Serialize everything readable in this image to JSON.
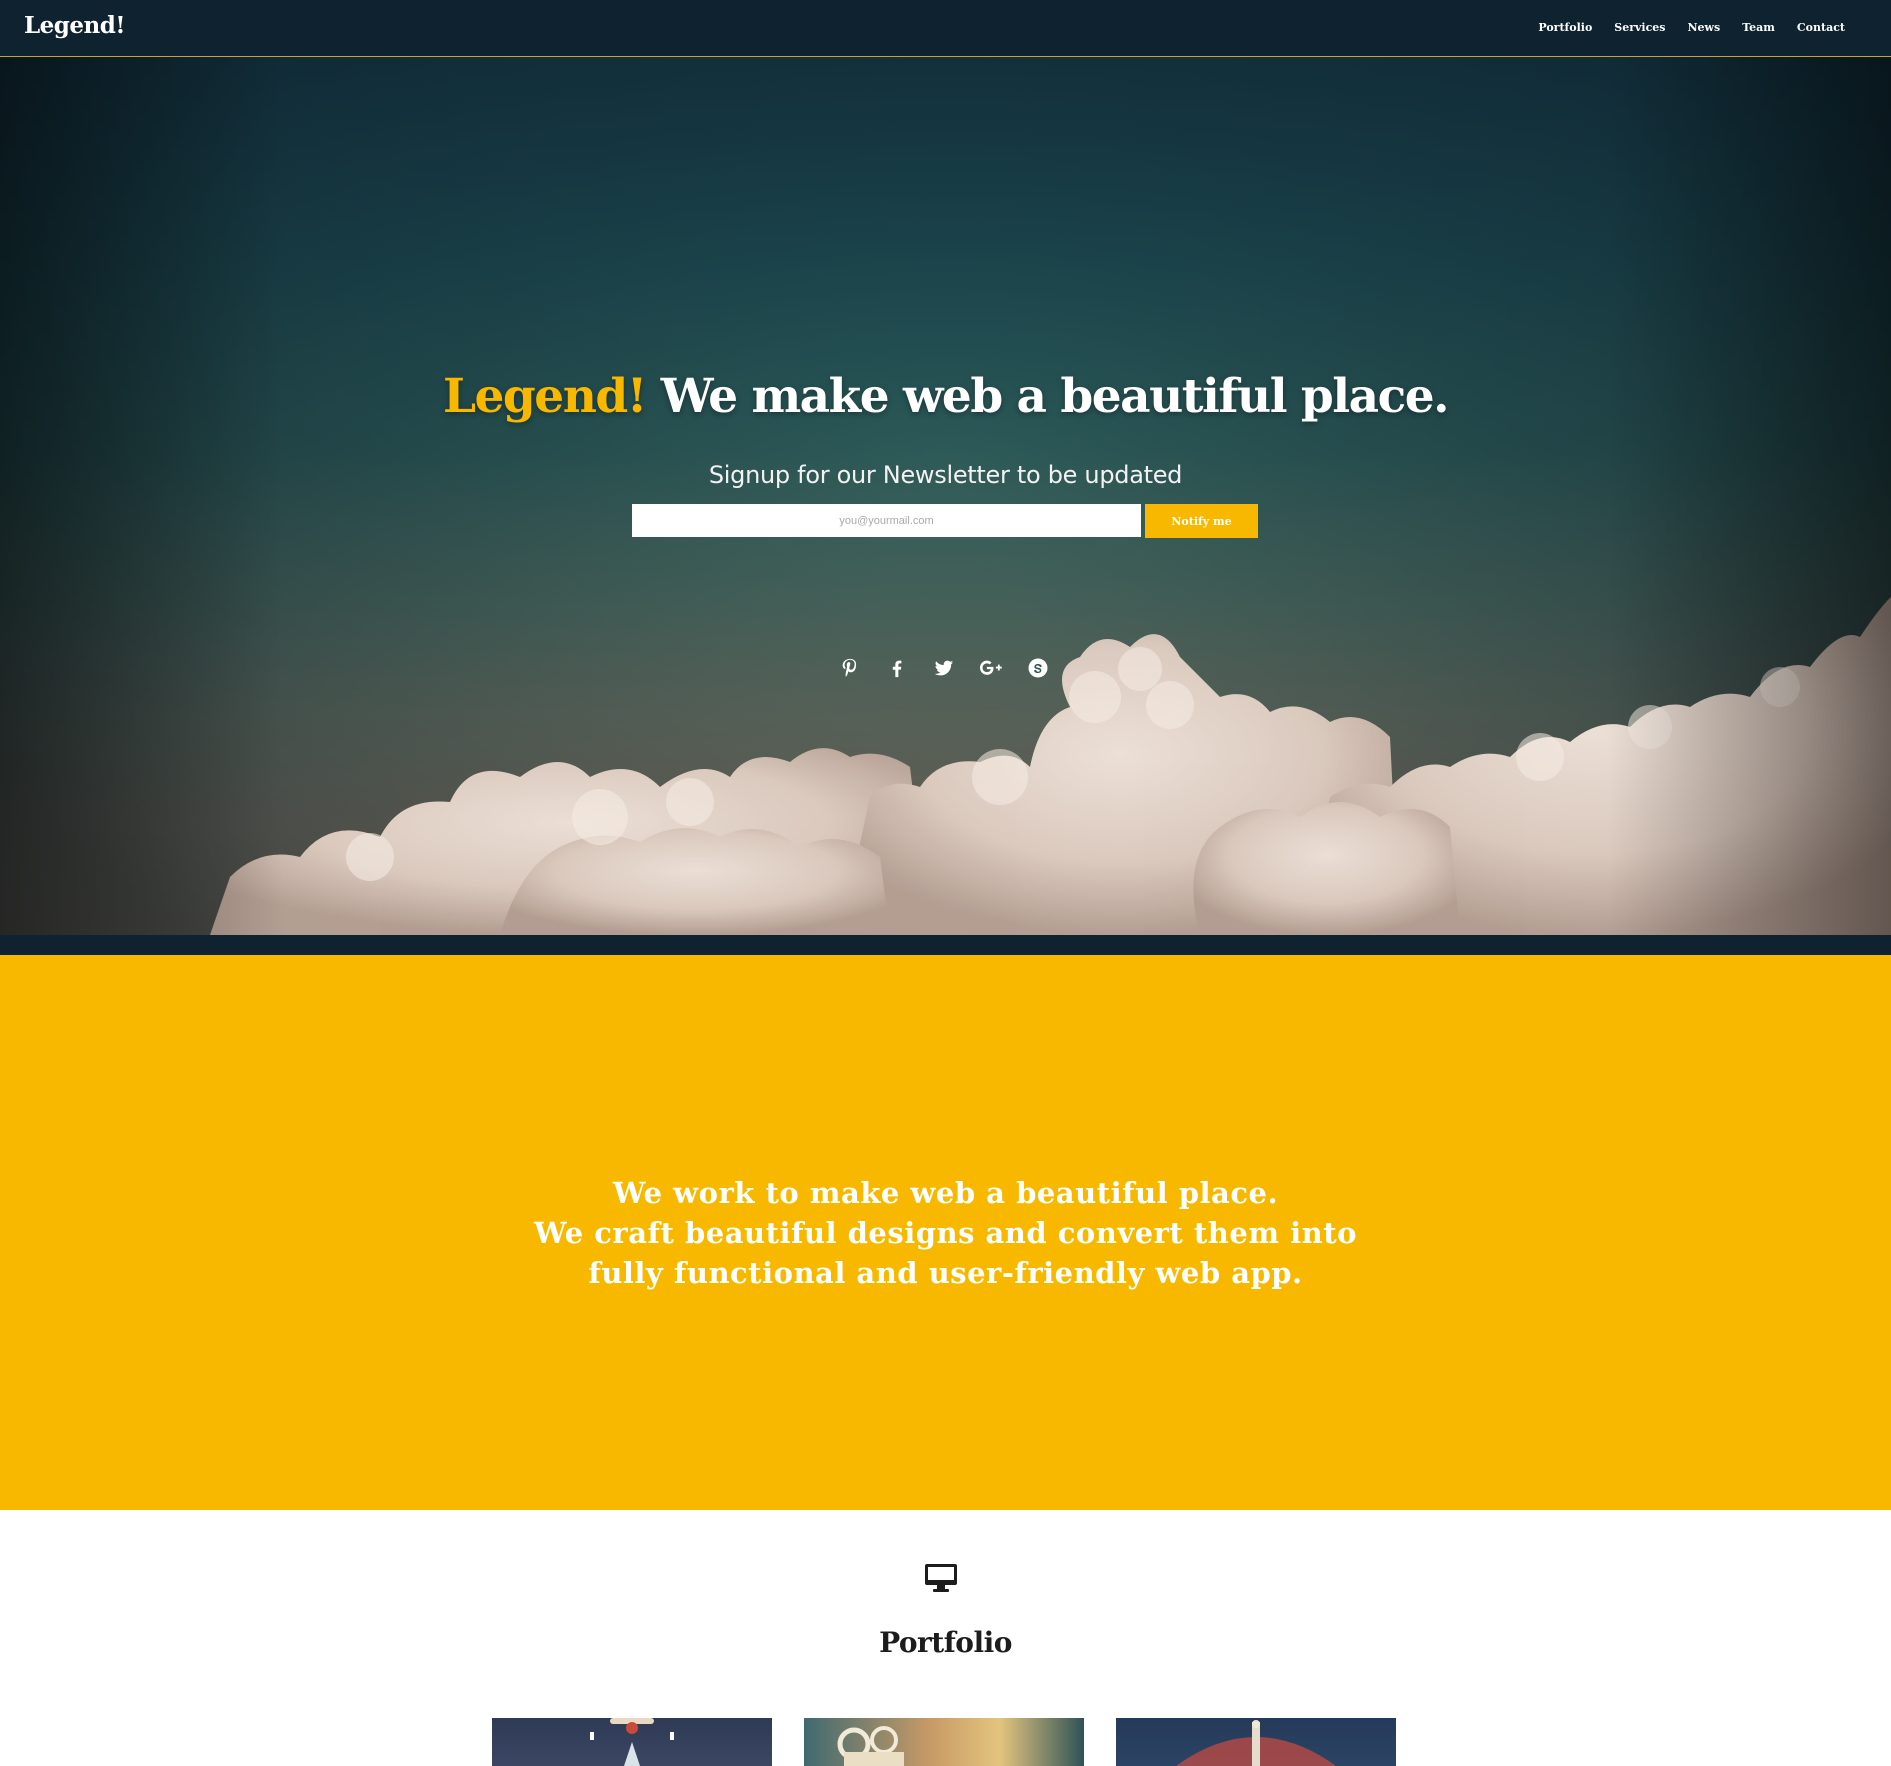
{
  "nav": {
    "brand": "Legend!",
    "links": [
      "Portfolio",
      "Services",
      "News",
      "Team",
      "Contact"
    ]
  },
  "hero": {
    "title_accent": "Legend!",
    "title_rest": " We make web a beautiful place.",
    "subtitle": "Signup for our Newsletter to be updated",
    "email_placeholder": "you@yourmail.com",
    "notify_label": "Notify me",
    "social_icons": [
      "pinterest-icon",
      "facebook-icon",
      "twitter-icon",
      "google-plus-icon",
      "skype-icon"
    ]
  },
  "about": {
    "lines": [
      "We work to make web a beautiful place.",
      "We craft beautiful designs and convert them into",
      "fully functional and user-friendly web app."
    ]
  },
  "portfolio": {
    "icon": "monitor-icon",
    "title": "Portfolio"
  },
  "colors": {
    "accent": "#f9b800",
    "navbar": "#0e2230",
    "text_dark": "#1c1c1c"
  }
}
